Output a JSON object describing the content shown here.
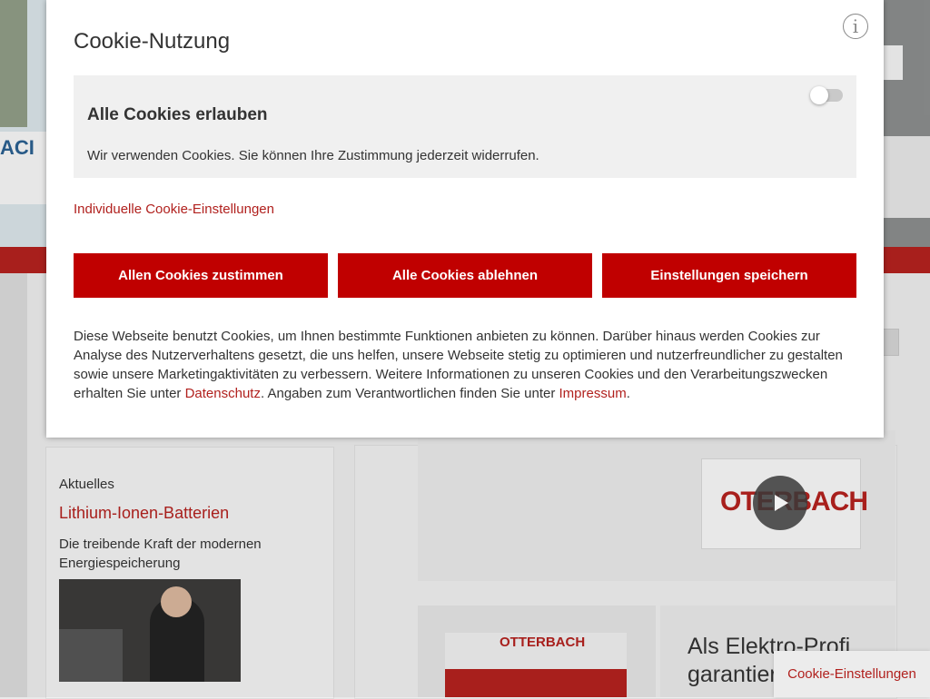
{
  "background": {
    "hero_left_text": "ACI",
    "video_logo_text": "OTERBACH",
    "card_image_logo": "OTTERBACH",
    "news": {
      "label": "Aktuelles",
      "title": "Lithium-Ionen-Batterien",
      "description": "Die treibende Kraft der modernen Energiespeicherung"
    },
    "card_heading": "Als Elektro-Profi garantieren"
  },
  "cookie_modal": {
    "title": "Cookie-Nutzung",
    "info_icon": "info-icon",
    "allow_all": {
      "title": "Alle Cookies erlauben",
      "description": "Wir verwenden Cookies. Sie können Ihre Zustimmung jederzeit widerrufen.",
      "toggle_on": false
    },
    "individual_link": "Individuelle Cookie-Einstellungen",
    "buttons": {
      "accept": "Allen Cookies zustimmen",
      "reject": "Alle Cookies ablehnen",
      "save": "Einstellungen speichern"
    },
    "policy": {
      "text_before": "Diese Webseite benutzt Cookies, um Ihnen bestimmte Funktionen anbieten zu können. Darüber hinaus werden Cookies zur Analyse des Nutzerverhaltens gesetzt, die uns helfen, unsere Webseite stetig zu optimieren und nutzerfreundlicher zu gestalten sowie unsere Marketingaktivitäten zu verbessern. Weitere Informationen zu unseren Cookies und den Verarbeitungszwecken erhalten Sie unter ",
      "link_privacy": "Datenschutz",
      "text_middle": ". Angaben zum Verantwortlichen finden Sie unter ",
      "link_imprint": "Impressum",
      "text_after": "."
    }
  },
  "cookie_settings_tab": "Cookie-Einstellungen",
  "colors": {
    "brand_red": "#c00000",
    "link_red": "#b1211e",
    "panel_grey": "#f0f0f0"
  }
}
